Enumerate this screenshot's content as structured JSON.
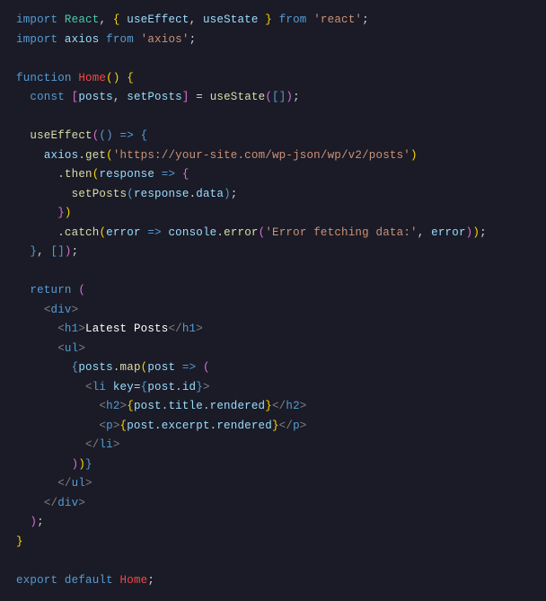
{
  "code": {
    "l1": {
      "imp": "import",
      "react": "React",
      "useEffect": "useEffect",
      "useState": "useState",
      "from": "from",
      "pkg": "'react'"
    },
    "l2": {
      "imp": "import",
      "axios": "axios",
      "from": "from",
      "pkg": "'axios'"
    },
    "l4": {
      "fn": "function",
      "name": "Home"
    },
    "l5": {
      "const": "const",
      "posts": "posts",
      "setPosts": "setPosts",
      "useState": "useState"
    },
    "l7": {
      "useEffect": "useEffect"
    },
    "l8": {
      "axios": "axios",
      "get": "get",
      "url": "'https://your-site.com/wp-json/wp/v2/posts'"
    },
    "l9": {
      "then": "then",
      "resp": "response"
    },
    "l10": {
      "setPosts": "setPosts",
      "resp": "response",
      "data": "data"
    },
    "l12": {
      "catch": "catch",
      "err": "error",
      "console": "console",
      "cerr": "error",
      "msg": "'Error fetching data:'",
      "errp": "error"
    },
    "l15": {
      "ret": "return"
    },
    "l16": {
      "div": "div"
    },
    "l17": {
      "h1": "h1",
      "txt": "Latest Posts"
    },
    "l18": {
      "ul": "ul"
    },
    "l19": {
      "posts": "posts",
      "map": "map",
      "post": "post"
    },
    "l20": {
      "li": "li",
      "key": "key",
      "postid": "post.id"
    },
    "l21": {
      "h2": "h2",
      "expr": "post.title.rendered"
    },
    "l22": {
      "p": "p",
      "expr": "post.excerpt.rendered"
    },
    "l23": {
      "li": "li"
    },
    "l25": {
      "ul": "ul"
    },
    "l26": {
      "div": "div"
    },
    "l30": {
      "exp": "export",
      "def": "default",
      "name": "Home"
    }
  }
}
